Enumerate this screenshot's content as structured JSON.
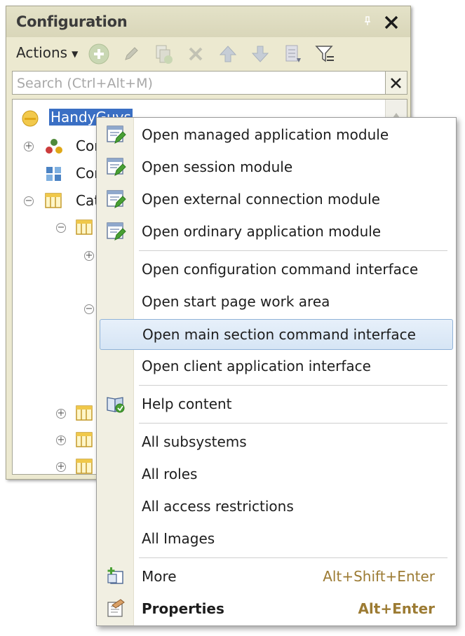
{
  "panel": {
    "title": "Configuration",
    "actions_label": "Actions",
    "search_placeholder": "Search (Ctrl+Alt+M)"
  },
  "tree": {
    "root": "HandyGuys",
    "items": [
      {
        "label": "Cor",
        "icon": "common-icon"
      },
      {
        "label": "Cor",
        "icon": "constants-icon"
      },
      {
        "label": "Cat",
        "icon": "catalogs-icon"
      }
    ]
  },
  "context_menu": {
    "items": [
      {
        "label": "Open managed application module",
        "icon": "module-icon"
      },
      {
        "label": "Open session module",
        "icon": "module-icon"
      },
      {
        "label": "Open external connection module",
        "icon": "module-icon"
      },
      {
        "label": "Open ordinary application module",
        "icon": "module-icon"
      },
      {
        "label": "Open configuration command interface"
      },
      {
        "label": "Open start page work area"
      },
      {
        "label": "Open main section command interface",
        "highlighted": true
      },
      {
        "label": "Open client application interface"
      },
      {
        "label": "Help content",
        "icon": "help-book-icon"
      },
      {
        "label": "All subsystems"
      },
      {
        "label": "All roles"
      },
      {
        "label": "All access restrictions"
      },
      {
        "label": "All Images"
      },
      {
        "label": "More",
        "shortcut": "Alt+Shift+Enter",
        "icon": "more-icon"
      },
      {
        "label": "Properties",
        "shortcut": "Alt+Enter",
        "icon": "properties-icon"
      }
    ]
  },
  "colors": {
    "panel_bg": "#ece9d0",
    "highlight_border": "#8fb2d8",
    "shortcut_text": "#9c7b33",
    "selection_bg": "#3a6fc4"
  }
}
